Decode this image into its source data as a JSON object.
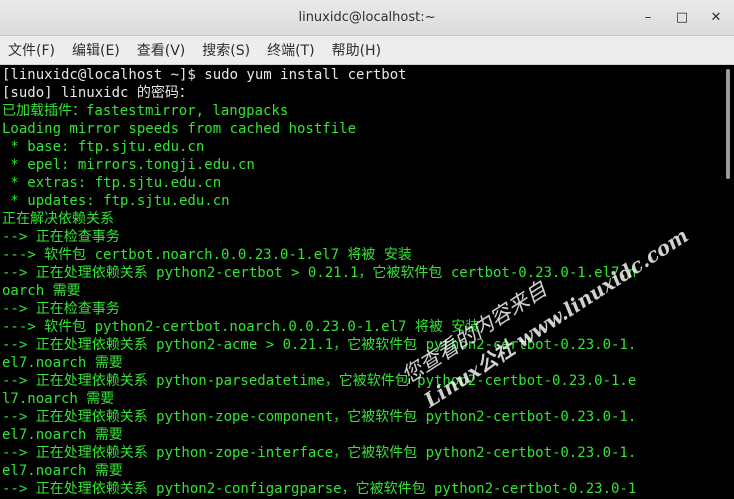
{
  "window": {
    "title": "linuxidc@localhost:~",
    "minimize_icon": "–",
    "maximize_icon": "□",
    "close_icon": "✕"
  },
  "menubar": {
    "items": [
      "文件(F)",
      "编辑(E)",
      "查看(V)",
      "搜索(S)",
      "终端(T)",
      "帮助(H)"
    ]
  },
  "terminal": {
    "lines": [
      "[linuxidc@localhost ~]$ sudo yum install certbot",
      "[sudo] linuxidc 的密码：",
      "已加载插件：fastestmirror, langpacks",
      "Loading mirror speeds from cached hostfile",
      " * base: ftp.sjtu.edu.cn",
      " * epel: mirrors.tongji.edu.cn",
      " * extras: ftp.sjtu.edu.cn",
      " * updates: ftp.sjtu.edu.cn",
      "正在解决依赖关系",
      "--> 正在检查事务",
      "---> 软件包 certbot.noarch.0.0.23.0-1.el7 将被 安装",
      "--> 正在处理依赖关系 python2-certbot > 0.21.1，它被软件包 certbot-0.23.0-1.el7.n",
      "oarch 需要",
      "--> 正在检查事务",
      "---> 软件包 python2-certbot.noarch.0.0.23.0-1.el7 将被 安装",
      "--> 正在处理依赖关系 python2-acme > 0.21.1，它被软件包 python2-certbot-0.23.0-1.",
      "el7.noarch 需要",
      "--> 正在处理依赖关系 python-parsedatetime，它被软件包 python2-certbot-0.23.0-1.e",
      "l7.noarch 需要",
      "--> 正在处理依赖关系 python-zope-component，它被软件包 python2-certbot-0.23.0-1.",
      "el7.noarch 需要",
      "--> 正在处理依赖关系 python-zope-interface，它被软件包 python2-certbot-0.23.0-1.",
      "el7.noarch 需要",
      "--> 正在处理依赖关系 python2-configargparse，它被软件包 python2-certbot-0.23.0-1"
    ],
    "text_color": "#33e433",
    "prompt_color": "#e8e8e8",
    "background": "#000000"
  },
  "watermark": {
    "line1": "您查看的内容来自",
    "line2": "Linux公社 www.linuxidc.com"
  }
}
